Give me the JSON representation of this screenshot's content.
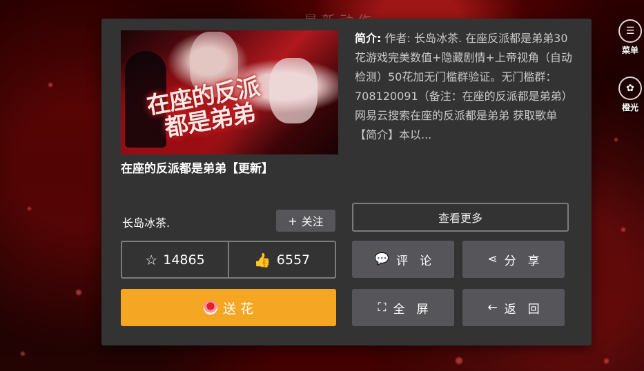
{
  "background": {
    "title": "最新动作"
  },
  "right_rail": {
    "items": [
      {
        "label": "菜单",
        "icon": "menu-icon"
      },
      {
        "label": "橙光",
        "icon": "orange-light-icon"
      }
    ]
  },
  "card": {
    "cover_title_art": "在座的反派都是弟弟",
    "title": "在座的反派都是弟弟【更新】",
    "intro_label": "简介:",
    "intro_text": " 作者: 长岛冰茶. 在座反派都是弟弟30花游戏完美数值+隐藏剧情+上帝视角（自动检测）50花加无门槛群验证。无门槛群：708120091（备注：在座的反派都是弟弟）网易云搜索在座的反派都是弟弟 获取歌单【简介】本以...",
    "author": "长岛冰茶.",
    "follow_label": "关注",
    "more_label": "查看更多",
    "stats": {
      "favorites": "14865",
      "likes": "6557"
    },
    "actions": {
      "comment": "评　论",
      "share": "分　享",
      "fullscreen": "全　屏",
      "back": "返　回"
    },
    "flower_label": "送 花"
  },
  "colors": {
    "panel": "#333334",
    "button": "#56565a",
    "flower": "#f5a623",
    "border": "#7c7c80"
  }
}
